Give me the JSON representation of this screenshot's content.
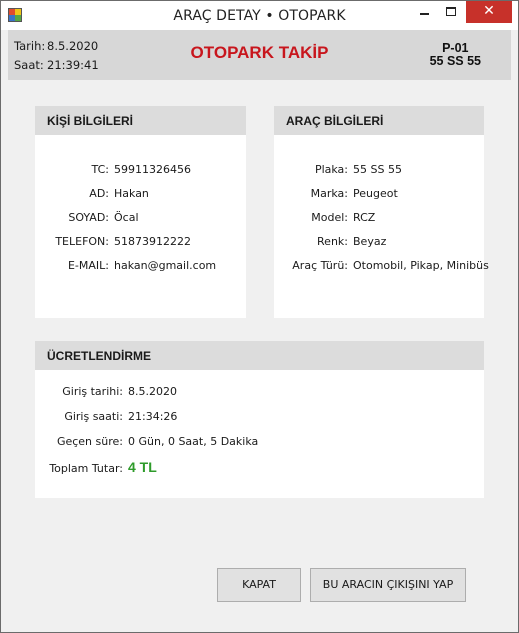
{
  "window": {
    "title": "ARAÇ DETAY • OTOPARK"
  },
  "header": {
    "date_label": "Tarih:",
    "date_value": "8.5.2020",
    "time_label": "Saat:",
    "time_value": "21:39:41",
    "title": "OTOPARK TAKİP",
    "spot": "P-01",
    "plate": "55 SS 55",
    "title_color": "#c8161d"
  },
  "person": {
    "heading": "KİŞİ BİLGİLERİ",
    "rows": [
      {
        "label": "TC:",
        "value": "59911326456"
      },
      {
        "label": "AD:",
        "value": "Hakan"
      },
      {
        "label": "SOYAD:",
        "value": "Öcal"
      },
      {
        "label": "TELEFON:",
        "value": "51873912222"
      },
      {
        "label": "E-MAIL:",
        "value": "hakan@gmail.com"
      }
    ]
  },
  "vehicle": {
    "heading": "ARAÇ BİLGİLERİ",
    "rows": [
      {
        "label": "Plaka:",
        "value": "55 SS 55"
      },
      {
        "label": "Marka:",
        "value": "Peugeot"
      },
      {
        "label": "Model:",
        "value": "RCZ"
      },
      {
        "label": "Renk:",
        "value": "Beyaz"
      },
      {
        "label": "Araç Türü:",
        "value": "Otomobil, Pikap, Minibüs"
      }
    ]
  },
  "pricing": {
    "heading": "ÜCRETLENDİRME",
    "rows": [
      {
        "label": "Giriş tarihi:",
        "value": "8.5.2020"
      },
      {
        "label": "Giriş saati:",
        "value": "21:34:26"
      },
      {
        "label": "Geçen süre:",
        "value": "0 Gün, 0 Saat, 5 Dakika"
      },
      {
        "label": "Toplam Tutar:",
        "value": "4 TL"
      }
    ],
    "total_color": "#2e9b2a"
  },
  "buttons": {
    "close_label": "KAPAT",
    "exit_label": "BU ARACIN ÇIKIŞINI YAP"
  },
  "titlebar_controls": {
    "close_glyph": "✕"
  }
}
